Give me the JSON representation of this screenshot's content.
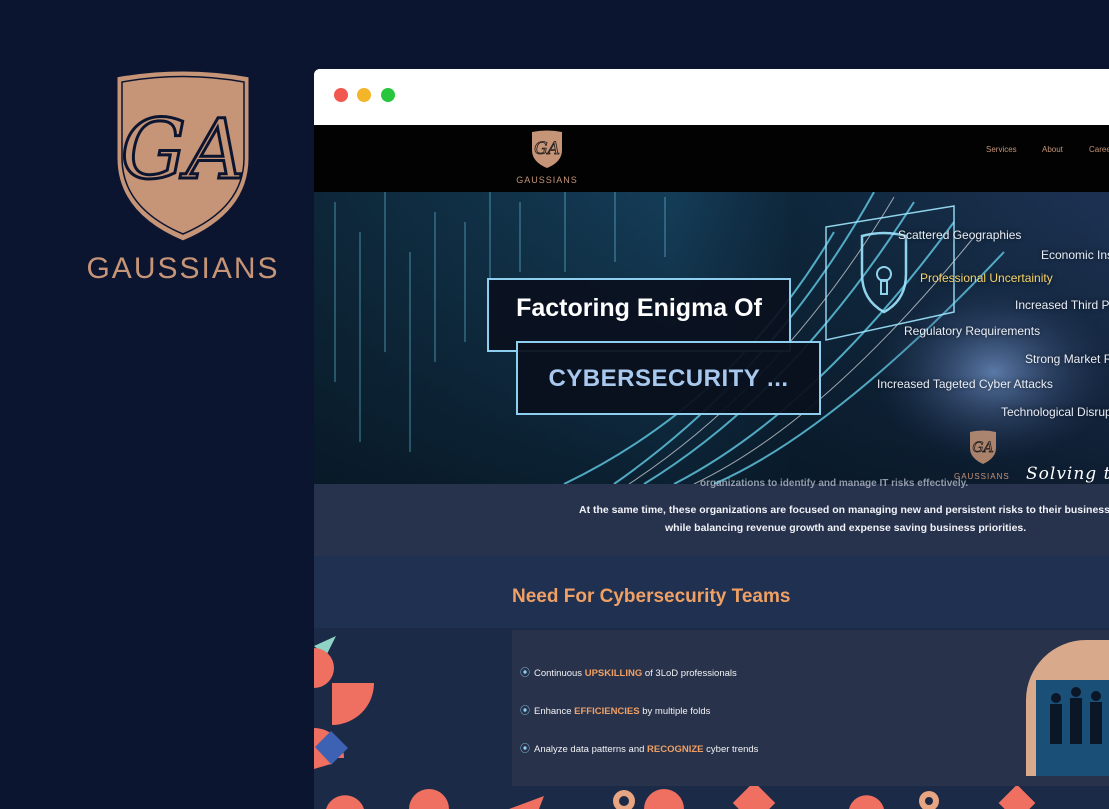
{
  "brand": {
    "monogram": "GA",
    "name": "GAUSSIANS"
  },
  "browser": {
    "dots": [
      "red",
      "yellow",
      "green"
    ]
  },
  "site": {
    "logo_text": "GAUSSIANS",
    "nav": [
      "Services",
      "About",
      "Career"
    ],
    "hero": {
      "title_line1": "Factoring Enigma Of",
      "title_line2": "CYBERSECURITY ...",
      "risks": [
        "Scattered Geographies",
        "Economic Instability",
        "Professional Uncertainity",
        "Increased Third Party",
        "Regulatory Requirements",
        "Strong Market Risks",
        "Increased Tageted Cyber Attacks",
        "Technological Disruption"
      ],
      "logo_text": "GAUSSIANS",
      "slogan": "Solving the"
    },
    "intro": {
      "cut_line": "organizations to identify and manage IT risks effectively.",
      "line1": "At the same time, these organizations are focused on managing new and persistent risks to their business,",
      "line2": "while balancing revenue growth and expense saving business priorities."
    },
    "need": {
      "title": "Need For Cybersecurity Teams",
      "features": [
        {
          "pre": "Continuous ",
          "highlight": "UPSKILLING",
          "post": " of 3LoD professionals"
        },
        {
          "pre": "Enhance ",
          "highlight": "EFFICIENCIES",
          "post": " by multiple folds"
        },
        {
          "pre": "Analyze data patterns and ",
          "highlight": "RECOGNIZE",
          "post": " cyber trends"
        }
      ]
    }
  },
  "colors": {
    "background": "#0c1530",
    "brand_copper": "#c69477",
    "accent_orange": "#f0a064",
    "accent_cyan": "#8ecff0"
  }
}
